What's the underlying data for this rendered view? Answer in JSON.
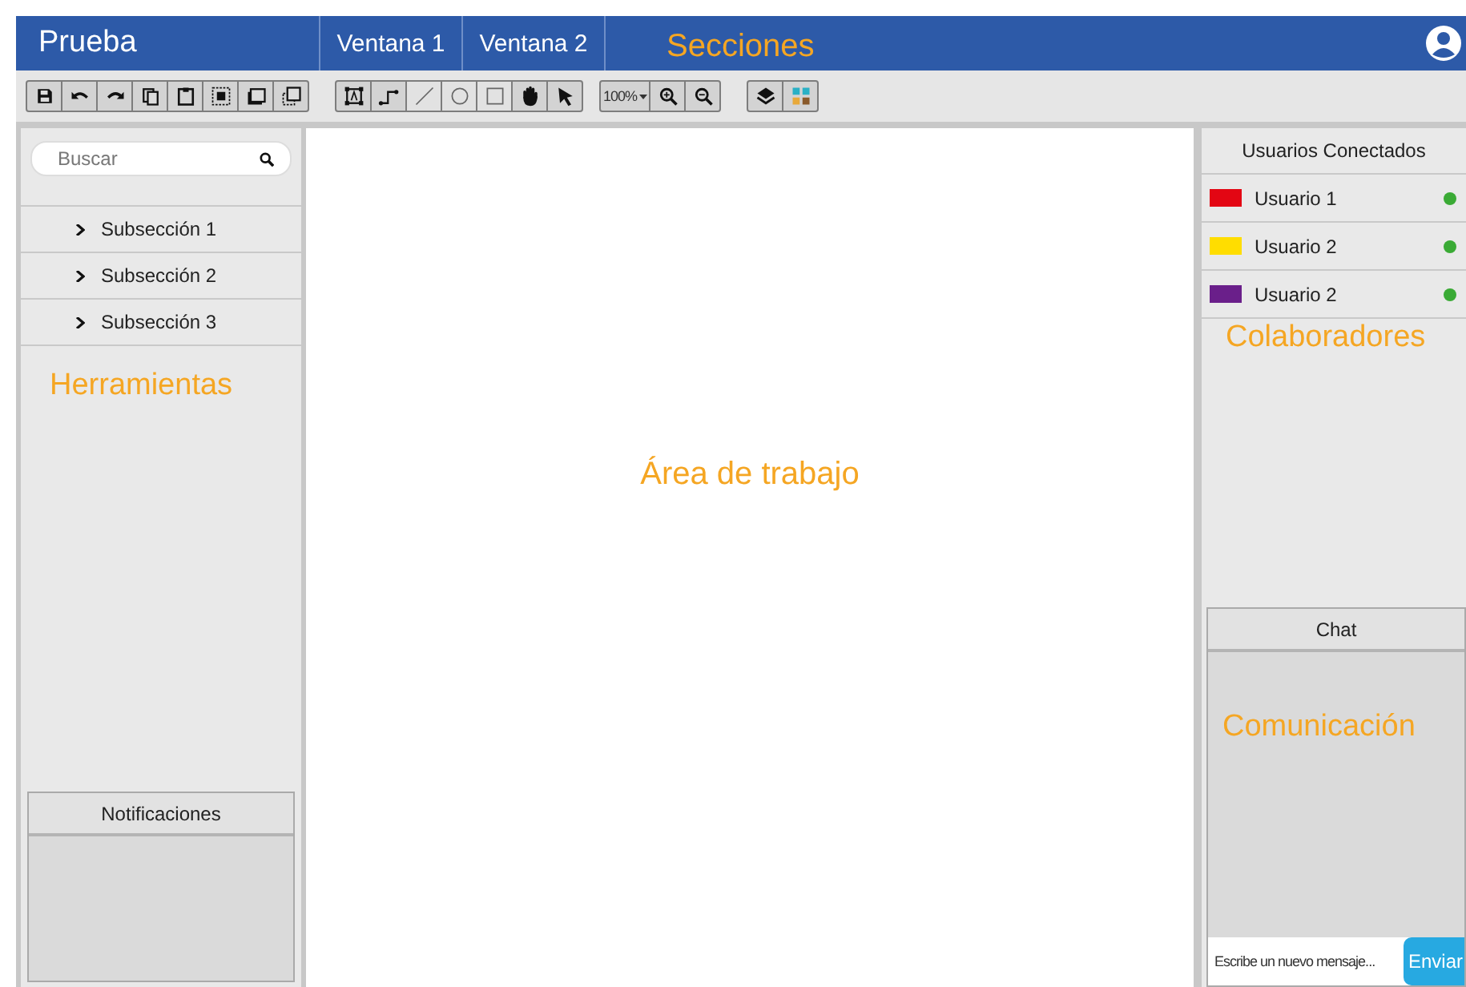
{
  "header": {
    "title": "Prueba",
    "tabs": [
      {
        "label": "Ventana 1",
        "selected": false
      },
      {
        "label": "Ventana 2",
        "selected": false
      }
    ],
    "annotation": "Secciones"
  },
  "toolbar": {
    "groups": [
      {
        "items": [
          {
            "kind": "icon",
            "disabled": false
          },
          {
            "kind": "icon",
            "disabled": false
          },
          {
            "kind": "icon",
            "disabled": false
          },
          {
            "kind": "icon",
            "disabled": false
          },
          {
            "kind": "icon",
            "disabled": false
          },
          {
            "kind": "icon",
            "disabled": false
          },
          {
            "kind": "icon",
            "disabled": false
          },
          {
            "kind": "icon",
            "disabled": false
          }
        ]
      },
      {
        "items": [
          {
            "kind": "icon",
            "disabled": false
          },
          {
            "kind": "icon",
            "disabled": false
          },
          {
            "kind": "icon",
            "disabled": true
          },
          {
            "kind": "icon",
            "disabled": true
          },
          {
            "kind": "icon",
            "disabled": true
          },
          {
            "kind": "icon",
            "disabled": false
          },
          {
            "kind": "icon",
            "disabled": false
          }
        ]
      },
      {
        "items": [
          {
            "kind": "zoom",
            "label": "100%",
            "disabled": false
          },
          {
            "kind": "icon",
            "disabled": false
          },
          {
            "kind": "icon",
            "disabled": false
          }
        ]
      },
      {
        "items": [
          {
            "kind": "icon",
            "disabled": false
          },
          {
            "kind": "icon",
            "disabled": false
          }
        ]
      }
    ]
  },
  "sidebar": {
    "search": {
      "placeholder": "Buscar"
    },
    "items": [
      {
        "label": "Subsección 1",
        "expanded": false
      },
      {
        "label": "Subsección 2",
        "expanded": false
      },
      {
        "label": "Subsección 3",
        "expanded": false
      }
    ],
    "annotation": "Herramientas",
    "notifications": {
      "title": "Notificaciones"
    }
  },
  "workspace": {
    "annotation": "Área de trabajo"
  },
  "collaborators": {
    "title": "Usuarios Conectados",
    "users": [
      {
        "name": "Usuario 1",
        "color": "#e30613",
        "online": true
      },
      {
        "name": "Usuario 2",
        "color": "#ffdd00",
        "online": true
      },
      {
        "name": "Usuario 2",
        "color": "#6a1f8a",
        "online": true
      }
    ],
    "annotation": "Colaboradores"
  },
  "chat": {
    "title": "Chat",
    "annotation": "Comunicación",
    "input": {
      "placeholder": "Escribe un nuevo mensaje..."
    },
    "send_button": "Enviar"
  }
}
